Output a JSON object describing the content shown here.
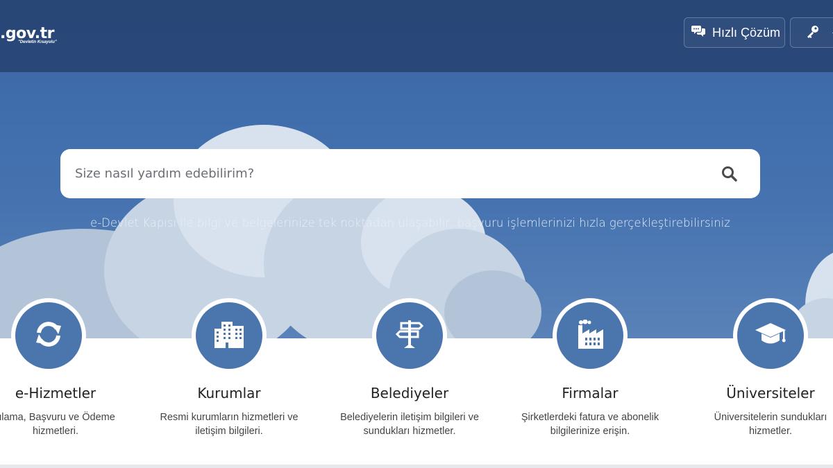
{
  "header": {
    "logo_text": ".gov.tr",
    "logo_sub": "\"Devletin Kısayolu\"",
    "quick_solution_label": "Hızlı Çözüm"
  },
  "search": {
    "placeholder": "Size nasıl yardım edebilirim?"
  },
  "tagline": "e-Devlet Kapısı ile bilgi ve belgelerinize tek noktadan ulaşabilir, başvuru işlemlerinizi hızla gerçekleştirebilirsiniz",
  "categories": [
    {
      "title": "e-Hizmetler",
      "desc_line1": "ulama, Başvuru ve Ödeme",
      "desc_line2": "hizmetleri.",
      "icon": "refresh-icon"
    },
    {
      "title": "Kurumlar",
      "desc_line1": "Resmi kurumların hizmetleri ve",
      "desc_line2": "iletişim bilgileri.",
      "icon": "building-icon"
    },
    {
      "title": "Belediyeler",
      "desc_line1": "Belediyelerin iletişim bilgileri ve",
      "desc_line2": "sundukları hizmetler.",
      "icon": "signpost-icon"
    },
    {
      "title": "Firmalar",
      "desc_line1": "Şirketlerdeki fatura ve abonelik",
      "desc_line2": "bilgilerinize erişin.",
      "icon": "factory-icon"
    },
    {
      "title": "Üniversiteler",
      "desc_line1": "Üniversitelerin sundukları",
      "desc_line2": "hizmetler.",
      "icon": "graduation-cap-icon"
    }
  ],
  "colors": {
    "hero_blue": "#3f6cab",
    "header_overlay": "#264270",
    "icon_circle": "#4a76ad"
  }
}
